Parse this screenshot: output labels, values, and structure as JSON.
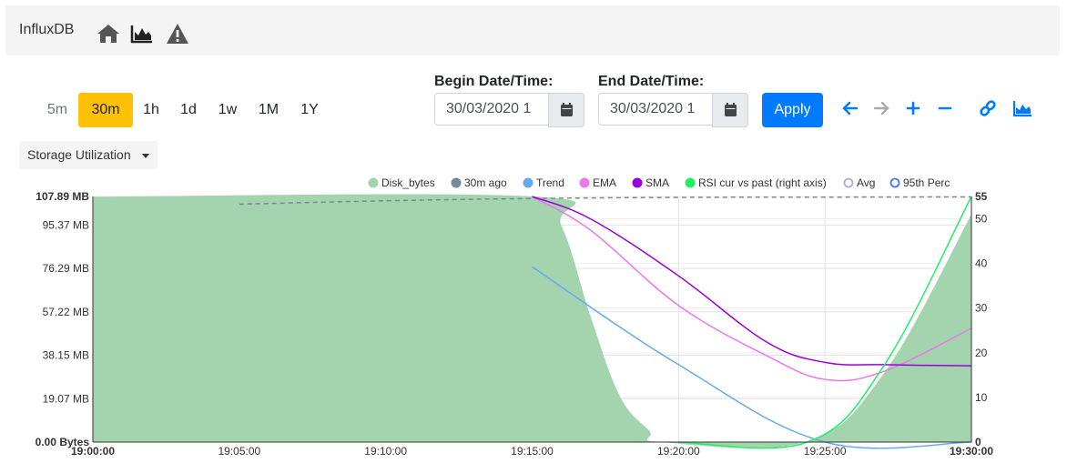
{
  "navbar": {
    "brand": "InfluxDB",
    "icons": [
      "home-icon",
      "area-chart-icon",
      "warning-icon"
    ]
  },
  "ranges": {
    "items": [
      "5m",
      "30m",
      "1h",
      "1d",
      "1w",
      "1M",
      "1Y"
    ],
    "active": "30m"
  },
  "begin": {
    "label": "Begin Date/Time:",
    "value": "30/03/2020 1"
  },
  "end": {
    "label": "End Date/Time:",
    "value": "30/03/2020 1"
  },
  "apply_label": "Apply",
  "tools": [
    "arrow-left-icon",
    "arrow-right-icon",
    "plus-icon",
    "minus-icon",
    "link-icon",
    "area-chart-icon"
  ],
  "metric_dropdown": {
    "selected": "Storage Utilization"
  },
  "colors": {
    "accent": "#007bff",
    "active_range": "#ffc107",
    "disk": "#a3d4ae",
    "ago": "#778899",
    "trend": "#66aaee",
    "ema": "#ee77ee",
    "sma": "#9900dd",
    "rsi": "#22ee66",
    "avg": "#aaaadd",
    "perc": "#4477ee"
  },
  "chart_data": {
    "type": "area",
    "x": [
      "19:00:00",
      "19:05:00",
      "19:10:00",
      "19:15:00",
      "19:20:00",
      "19:25:00",
      "19:30:00"
    ],
    "y_left_ticks": [
      "0.00 Bytes",
      "19.07 MB",
      "38.15 MB",
      "57.22 MB",
      "76.29 MB",
      "95.37 MB",
      "107.89 MB"
    ],
    "y_left_values": [
      0,
      19.07,
      38.15,
      57.22,
      76.29,
      95.37,
      107.89
    ],
    "ylim": [
      0,
      107.89
    ],
    "y_right_ticks": [
      "0",
      "10",
      "20",
      "30",
      "40",
      "50",
      "55"
    ],
    "y_right_values": [
      0,
      10,
      20,
      30,
      40,
      50,
      55
    ],
    "y_right_lim": [
      0,
      55
    ],
    "legend_position": "top-right",
    "grid": true,
    "series": [
      {
        "name": "Disk_bytes",
        "axis": "left",
        "style": "area",
        "points": [
          [
            0,
            107.8
          ],
          [
            15,
            107.89
          ],
          [
            16,
            95
          ],
          [
            17,
            55
          ],
          [
            18,
            20
          ],
          [
            19,
            5
          ],
          [
            19.4,
            0
          ],
          [
            24.3,
            0
          ],
          [
            27,
            30
          ],
          [
            30,
            100
          ]
        ]
      },
      {
        "name": "30m ago",
        "axis": "left",
        "style": "dashed",
        "points": [
          [
            5,
            104.5
          ],
          [
            10,
            106
          ],
          [
            15,
            107
          ],
          [
            20,
            107.5
          ],
          [
            25,
            107.6
          ],
          [
            30,
            107.7
          ]
        ]
      },
      {
        "name": "Trend",
        "axis": "left",
        "style": "line",
        "points": [
          [
            15,
            77
          ],
          [
            20,
            34
          ],
          [
            25,
            0
          ],
          [
            30,
            0
          ]
        ]
      },
      {
        "name": "EMA",
        "axis": "left",
        "style": "line",
        "points": [
          [
            15,
            107.89
          ],
          [
            17,
            93
          ],
          [
            20,
            60
          ],
          [
            23,
            38
          ],
          [
            25,
            27.5
          ],
          [
            27,
            31
          ],
          [
            30,
            50
          ]
        ]
      },
      {
        "name": "SMA",
        "axis": "left",
        "style": "line",
        "points": [
          [
            15,
            107.89
          ],
          [
            17,
            98
          ],
          [
            20,
            73
          ],
          [
            23,
            44
          ],
          [
            25,
            35
          ],
          [
            27,
            34
          ],
          [
            30,
            33.5
          ]
        ]
      },
      {
        "name": "RSI cur vs past (right axis)",
        "axis": "right",
        "style": "line",
        "points": [
          [
            20,
            0
          ],
          [
            24.4,
            0
          ],
          [
            27,
            17
          ],
          [
            30,
            55
          ]
        ]
      },
      {
        "name": "Avg",
        "axis": "left",
        "style": "hollow",
        "points": []
      },
      {
        "name": "95th Perc",
        "axis": "left",
        "style": "hollow",
        "points": []
      }
    ]
  }
}
